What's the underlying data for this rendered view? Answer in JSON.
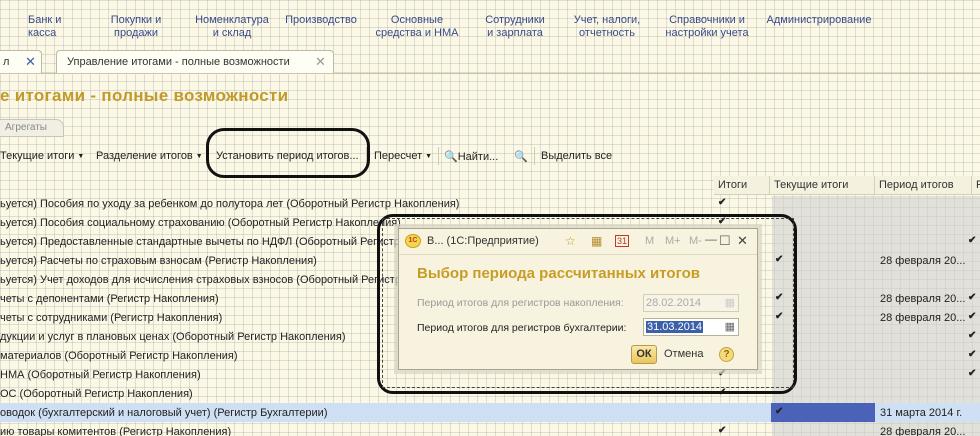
{
  "menu": [
    {
      "label": "Банк и\nкасса",
      "left": 0
    },
    {
      "label": "Покупки и\nпродажи",
      "left": 0
    },
    {
      "label": "Номенклатура\nи склад",
      "left": 0
    },
    {
      "label": "Производство",
      "left": 0
    },
    {
      "label": "Основные\nсредства и НМА",
      "left": 0
    },
    {
      "label": "Сотрудники\nи зарплата",
      "left": 0
    },
    {
      "label": "Учет, налоги,\nотчетность",
      "left": 0
    },
    {
      "label": "Справочники и\nнастройки учета",
      "left": 0
    },
    {
      "label": "Администрирование",
      "left": 0
    }
  ],
  "tabs": {
    "first_partial": "л",
    "active": "Управление итогами - полные возможности",
    "close_glyph": "✕"
  },
  "page_title": "е итогами - полные возможности",
  "subtab": "Агрегаты",
  "toolbar": {
    "current_totals": "Текущие итоги",
    "split_totals": "Разделение итогов",
    "set_period": "Установить период итогов...",
    "recalc": "Пересчет",
    "find": "Найти...",
    "select_all": "Выделить все"
  },
  "columns": {
    "totals": "Итоги",
    "current_totals": "Текущие итоги",
    "period": "Период итогов",
    "extra": "Р"
  },
  "rows": [
    {
      "text": "ьуется) Пособия по уходу за ребенком до полутора лет (Оборотный Регистр Накопления)",
      "totals": true,
      "current": false,
      "period": ""
    },
    {
      "text": "ьуется) Пособия социальному страхованию (Оборотный Регистр Накопления)",
      "totals": true,
      "current": false,
      "period": ""
    },
    {
      "text": "ьуется) Предоставленные стандартные вычеты по НДФЛ (Оборотный Регистр Накопления)",
      "totals": true,
      "current": false,
      "period": ""
    },
    {
      "text": "ьуется) Расчеты по страховым взносам (Регистр Накопления)",
      "totals": true,
      "current": true,
      "period": "28 февраля 20..."
    },
    {
      "text": "ьуется) Учет доходов для исчисления страховых взносов (Оборотный Регистр Накопления)",
      "totals": true,
      "current": false,
      "period": ""
    },
    {
      "text": "четы с депонентами (Регистр Накопления)",
      "totals": true,
      "current": true,
      "period": "28 февраля 20..."
    },
    {
      "text": "четы с сотрудниками (Регистр Накопления)",
      "totals": true,
      "current": true,
      "period": "28 февраля 20..."
    },
    {
      "text": "дукции и услуг в плановых ценах (Оборотный Регистр Накопления)",
      "totals": true,
      "current": false,
      "period": ""
    },
    {
      "text": "материалов (Оборотный Регистр Накопления)",
      "totals": true,
      "current": false,
      "period": ""
    },
    {
      "text": "НМА (Оборотный Регистр Накопления)",
      "totals": true,
      "current": false,
      "period": ""
    },
    {
      "text": "ОС (Оборотный Регистр Накопления)",
      "totals": true,
      "current": false,
      "period": ""
    },
    {
      "text": "оводок (бухгалтерский и налоговый учет) (Регистр Бухгалтерии)",
      "totals": false,
      "current": true,
      "period": "31 марта 2014 г."
    },
    {
      "text": "ию товары комитентов (Регистр Накопления)",
      "totals": true,
      "current": false,
      "period": "28 февраля 20..."
    }
  ],
  "dialog": {
    "window_title": "В...  (1С:Предприятие)",
    "title": "Выбор периода рассчитанных итогов",
    "accum_label": "Период итогов для регистров накопления:",
    "accum_value": "28.02.2014",
    "acct_label": "Период итогов для регистров бухгалтерии:",
    "acct_value": "31.03.2014",
    "ok": "ОК",
    "cancel": "Отмена",
    "help": "?",
    "toolbar_glyphs": [
      "☆",
      "▦",
      "31",
      "M",
      "M+",
      "M-",
      "—",
      "☐",
      "✕"
    ]
  },
  "colors": {
    "title": "#c19a2a",
    "selection": "#4a63b8"
  }
}
